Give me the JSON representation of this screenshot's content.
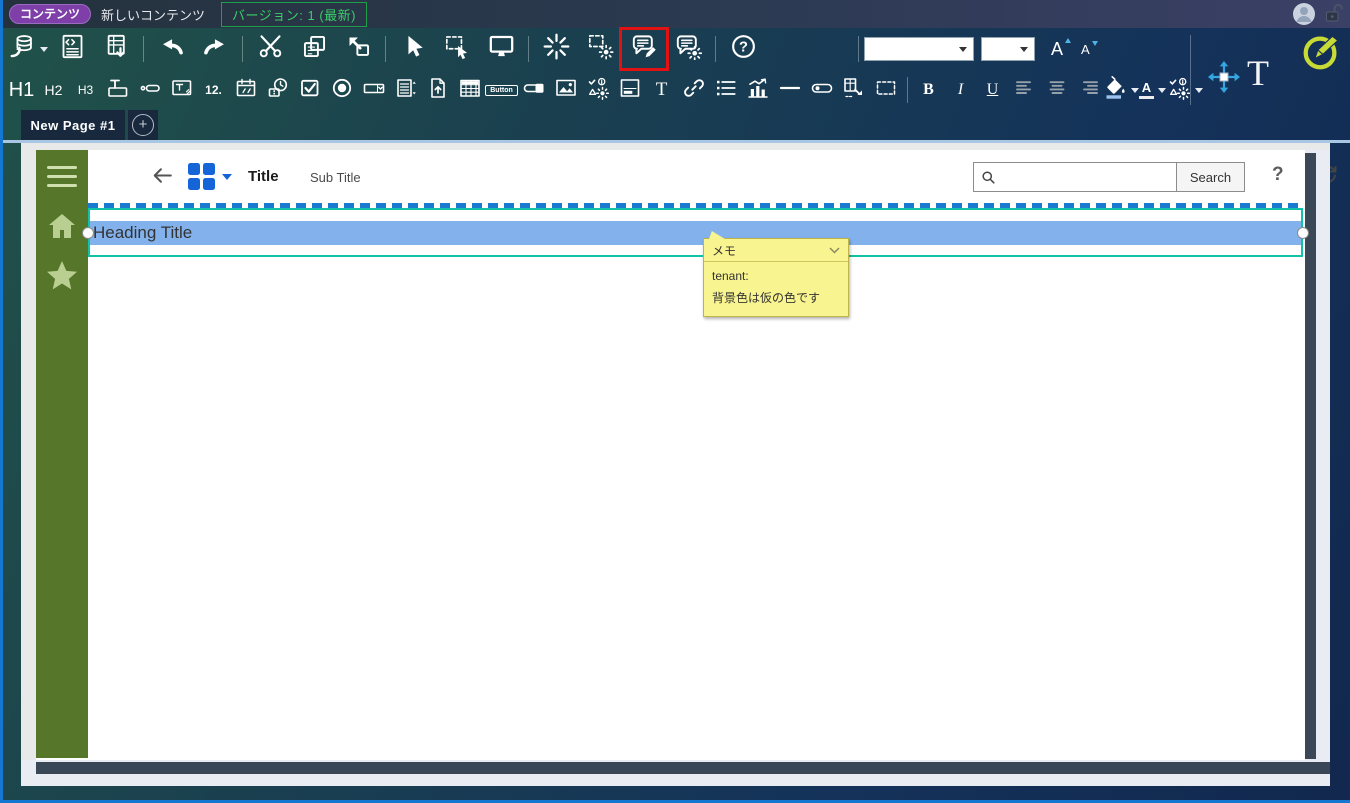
{
  "header": {
    "content_badge": "コンテンツ",
    "title": "新しいコンテンツ",
    "version_badge": "バージョン: 1 (最新)"
  },
  "toolbar": {
    "row1_groups": [
      [
        "deploy-database",
        "code-view",
        "export-sheet"
      ],
      [
        "undo",
        "redo"
      ],
      [
        "cut",
        "copy",
        "paste"
      ],
      [
        "select-cursor",
        "select-area",
        "device-preview"
      ],
      [
        "run-burst",
        "selection-settings",
        "memo-edit",
        "memo-settings"
      ],
      [
        "help"
      ]
    ],
    "highlighted": "memo-edit",
    "font_family_value": "",
    "font_size_value": "",
    "increase_font_label": "A",
    "decrease_font_label": "A",
    "text_tool_label": "T",
    "row2_items": [
      {
        "name": "heading-1",
        "text": "H1",
        "cls": "t-h1"
      },
      {
        "name": "heading-2",
        "text": "H2",
        "cls": "t-h2"
      },
      {
        "name": "heading-3",
        "text": "H3",
        "cls": "t-h3"
      },
      {
        "name": "text-field"
      },
      {
        "name": "label-field"
      },
      {
        "name": "text-area"
      },
      {
        "name": "number-field",
        "text": "12.",
        "cls": "t-num"
      },
      {
        "name": "date-picker"
      },
      {
        "name": "time-picker"
      },
      {
        "name": "checkbox"
      },
      {
        "name": "radio-button"
      },
      {
        "name": "combo-box"
      },
      {
        "name": "list-box"
      },
      {
        "name": "file-upload"
      },
      {
        "name": "table"
      },
      {
        "name": "button-control",
        "text": "Button",
        "cls": "t-boxed"
      },
      {
        "name": "toggle"
      },
      {
        "name": "image"
      },
      {
        "name": "status-symbols"
      },
      {
        "name": "panel"
      },
      {
        "name": "text",
        "text": "T",
        "cls": "t-serif"
      },
      {
        "name": "hyperlink"
      },
      {
        "name": "list-view"
      },
      {
        "name": "chart"
      },
      {
        "name": "horizontal-line"
      },
      {
        "name": "capsule"
      },
      {
        "name": "insert-template"
      },
      {
        "name": "container"
      },
      {
        "sep": true
      },
      {
        "name": "bold",
        "text": "B",
        "cls": "t-b"
      },
      {
        "name": "italic",
        "text": "I",
        "cls": "t-i"
      },
      {
        "name": "underline",
        "text": "U",
        "cls": "t-u"
      },
      {
        "name": "align-left"
      },
      {
        "name": "align-center"
      },
      {
        "name": "align-right"
      },
      {
        "name": "background-color",
        "caret": true
      },
      {
        "name": "font-color",
        "text": "A",
        "caret": true,
        "fontcolor": true
      },
      {
        "name": "symbol-set",
        "caret": true
      }
    ]
  },
  "tabbar": {
    "active_tab": "New Page #1",
    "add_button": "+"
  },
  "canvas": {
    "appbar": {
      "title": "Title",
      "subtitle": "Sub Title",
      "search_value": "",
      "search_button": "Search",
      "help": "?"
    },
    "heading": {
      "text": "Heading Title"
    },
    "memo": {
      "title": "メモ",
      "line1": "tenant:",
      "line2": "背景色は仮の色です"
    }
  },
  "colors": {
    "selection_teal": "#12c1a7",
    "heading_bg": "#82b1ec",
    "dash_blue": "#1a7ad0",
    "memo_bg": "#f8f48f",
    "highlight_red": "#e31212",
    "sidebar_green": "#567629",
    "accent_blue_grid": "#1565d8"
  }
}
